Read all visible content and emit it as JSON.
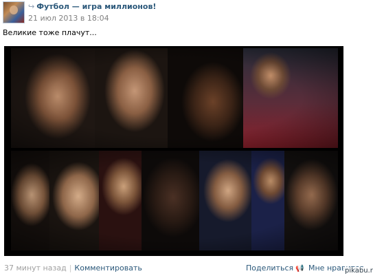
{
  "post": {
    "group_name": "Футбол — игра миллионов!",
    "date": "21 июл 2013 в 18:04",
    "text": "Великие тоже плачут..."
  },
  "footer": {
    "time_ago": "37 минут назад",
    "separator": "|",
    "comment_label": "Комментировать",
    "share_label": "Поделиться",
    "like_label": "Мне нравится"
  },
  "watermark": "pikabu.ru",
  "icons": {
    "repost": "↪",
    "share": "📢",
    "like": "♥"
  },
  "colors": {
    "link": "#2b587a",
    "muted": "#808080",
    "photo_bg": "#000000"
  }
}
